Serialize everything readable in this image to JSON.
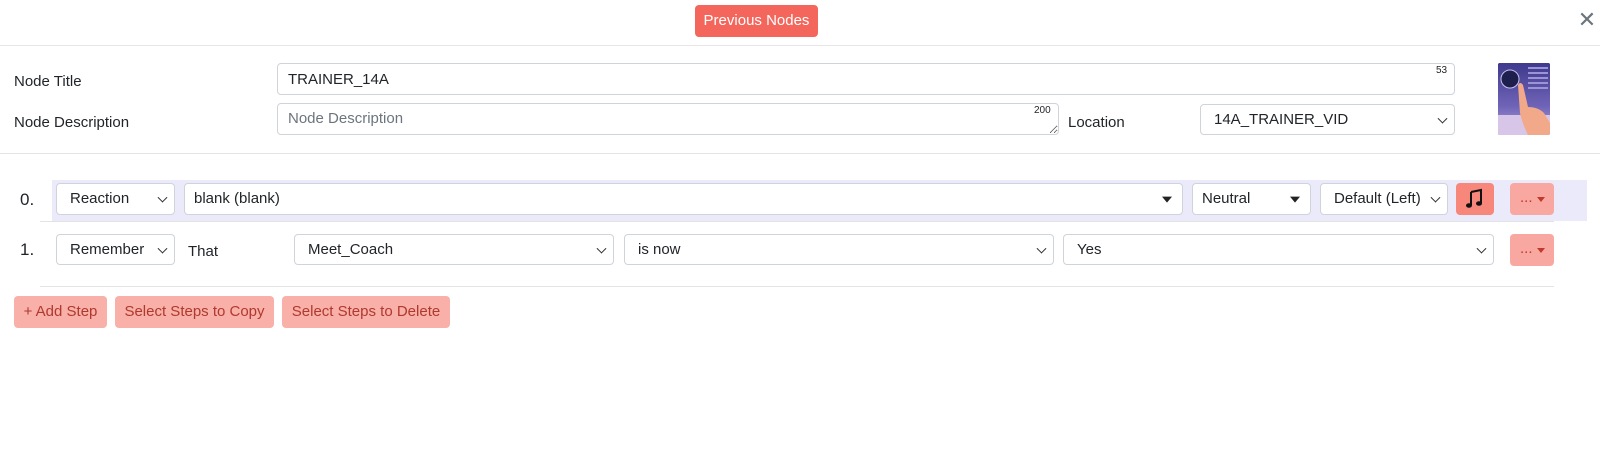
{
  "header": {
    "previous_nodes_label": "Previous Nodes",
    "close_glyph": "✕"
  },
  "node": {
    "title_label": "Node Title",
    "title_value": "TRAINER_14A",
    "title_counter": "53",
    "description_label": "Node Description",
    "description_value": "",
    "description_placeholder": "Node Description",
    "description_counter": "200",
    "location_label": "Location",
    "location_value": "14A_TRAINER_VID"
  },
  "steps": [
    {
      "number": "0.",
      "type": "Reaction",
      "reaction": "blank (blank)",
      "emotion": "Neutral",
      "position": "Default (Left)",
      "more_label": "..."
    },
    {
      "number": "1.",
      "type": "Remember",
      "that_label": "That",
      "variable": "Meet_Coach",
      "operator": "is now",
      "value": "Yes",
      "more_label": "..."
    }
  ],
  "actions": {
    "add_step": "+ Add Step",
    "copy_steps": "Select Steps to Copy",
    "delete_steps": "Select Steps to Delete"
  },
  "colors": {
    "primary": "#f4665c",
    "music_button": "#f8877b",
    "light_button": "#f8b0a8",
    "row_highlight": "#eaeafb"
  },
  "icons": {
    "close": "close-icon",
    "music": "music-note-icon",
    "dropdown": "chevron-down-icon"
  }
}
